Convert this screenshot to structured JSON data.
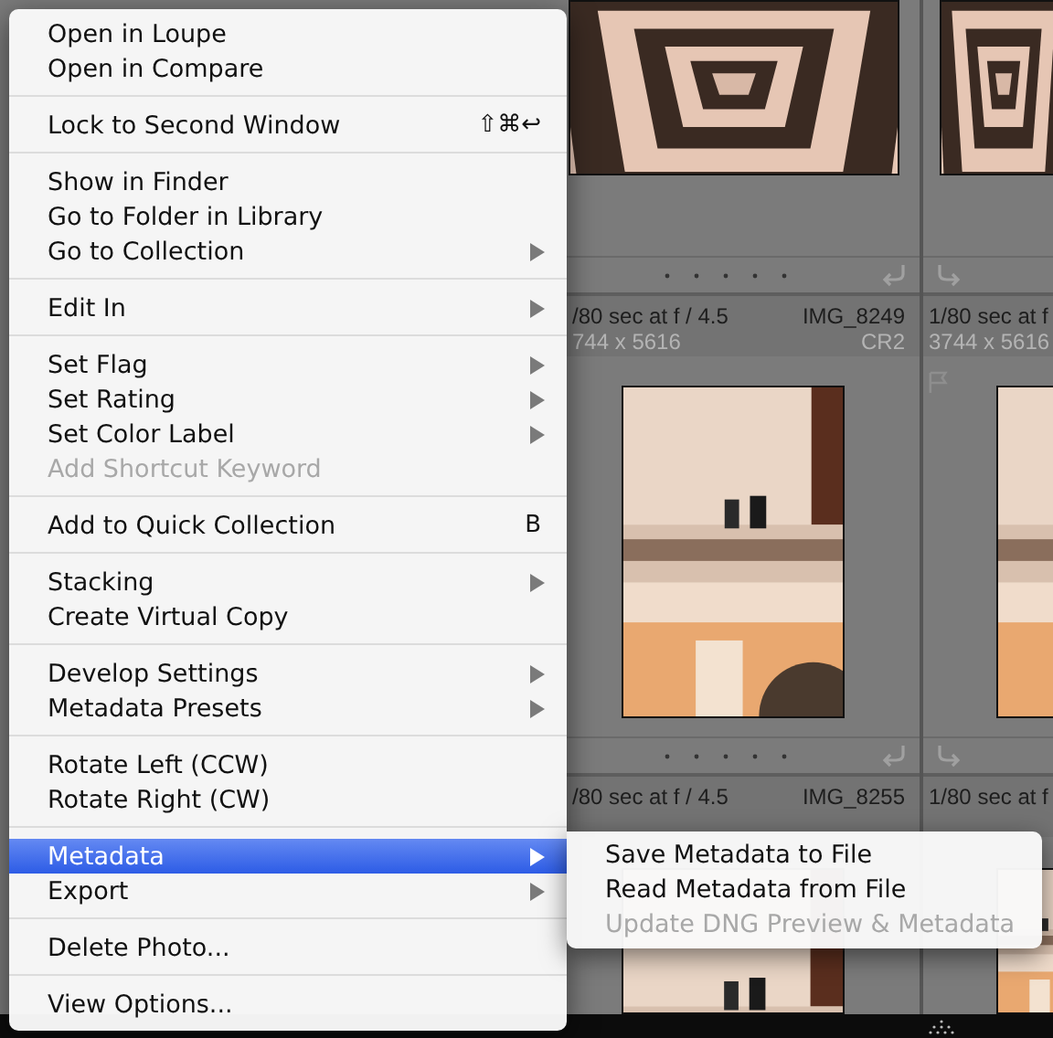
{
  "grid": {
    "rows": [
      {
        "cells": [
          {
            "kind": "picture",
            "exposure": "/80 sec at f / 4.5",
            "filename": "IMG_8249",
            "dimensions": "744 x 5616",
            "format": "CR2"
          },
          {
            "kind": "picture",
            "exposure": "1/80 sec at f",
            "dimensions": "3744 x 5616"
          }
        ]
      },
      {
        "cells": [
          {
            "kind": "picture",
            "exposure": "/80 sec at f / 4.5",
            "filename": "IMG_8255"
          },
          {
            "kind": "picture",
            "exposure": "1/80 sec at f"
          }
        ]
      },
      {
        "cells": [
          {
            "kind": "picture"
          },
          {
            "kind": "picture"
          }
        ]
      }
    ]
  },
  "menu": {
    "groups": [
      {
        "items": [
          {
            "label": "Open in Loupe",
            "submenu": false,
            "disabled": false,
            "selected": false
          },
          {
            "label": "Open in Compare",
            "submenu": false,
            "disabled": false,
            "selected": false
          }
        ]
      },
      {
        "items": [
          {
            "label": "Lock to Second Window",
            "shortcut": "⇧⌘↩",
            "submenu": false,
            "disabled": false,
            "selected": false
          }
        ]
      },
      {
        "items": [
          {
            "label": "Show in Finder",
            "submenu": false,
            "disabled": false,
            "selected": false
          },
          {
            "label": "Go to Folder in Library",
            "submenu": false,
            "disabled": false,
            "selected": false
          },
          {
            "label": "Go to Collection",
            "submenu": true,
            "disabled": false,
            "selected": false
          }
        ]
      },
      {
        "items": [
          {
            "label": "Edit In",
            "submenu": true,
            "disabled": false,
            "selected": false
          }
        ]
      },
      {
        "items": [
          {
            "label": "Set Flag",
            "submenu": true,
            "disabled": false,
            "selected": false
          },
          {
            "label": "Set Rating",
            "submenu": true,
            "disabled": false,
            "selected": false
          },
          {
            "label": "Set Color Label",
            "submenu": true,
            "disabled": false,
            "selected": false
          },
          {
            "label": "Add Shortcut Keyword",
            "submenu": false,
            "disabled": true,
            "selected": false
          }
        ]
      },
      {
        "items": [
          {
            "label": "Add to Quick Collection",
            "shortcut": "B",
            "submenu": false,
            "disabled": false,
            "selected": false
          }
        ]
      },
      {
        "items": [
          {
            "label": "Stacking",
            "submenu": true,
            "disabled": false,
            "selected": false
          },
          {
            "label": "Create Virtual Copy",
            "submenu": false,
            "disabled": false,
            "selected": false
          }
        ]
      },
      {
        "items": [
          {
            "label": "Develop Settings",
            "submenu": true,
            "disabled": false,
            "selected": false
          },
          {
            "label": "Metadata Presets",
            "submenu": true,
            "disabled": false,
            "selected": false
          }
        ]
      },
      {
        "items": [
          {
            "label": "Rotate Left (CCW)",
            "submenu": false,
            "disabled": false,
            "selected": false
          },
          {
            "label": "Rotate Right (CW)",
            "submenu": false,
            "disabled": false,
            "selected": false
          }
        ]
      },
      {
        "items": [
          {
            "label": "Metadata",
            "submenu": true,
            "disabled": false,
            "selected": true
          },
          {
            "label": "Export",
            "submenu": true,
            "disabled": false,
            "selected": false
          }
        ]
      },
      {
        "items": [
          {
            "label": "Delete Photo...",
            "submenu": false,
            "disabled": false,
            "selected": false
          }
        ]
      },
      {
        "items": [
          {
            "label": "View Options...",
            "submenu": false,
            "disabled": false,
            "selected": false
          }
        ]
      }
    ]
  },
  "submenu": {
    "items": [
      {
        "label": "Save Metadata to File",
        "disabled": false
      },
      {
        "label": "Read Metadata from File",
        "disabled": false
      },
      {
        "label": "Update DNG Preview & Metadata",
        "disabled": true
      }
    ]
  }
}
